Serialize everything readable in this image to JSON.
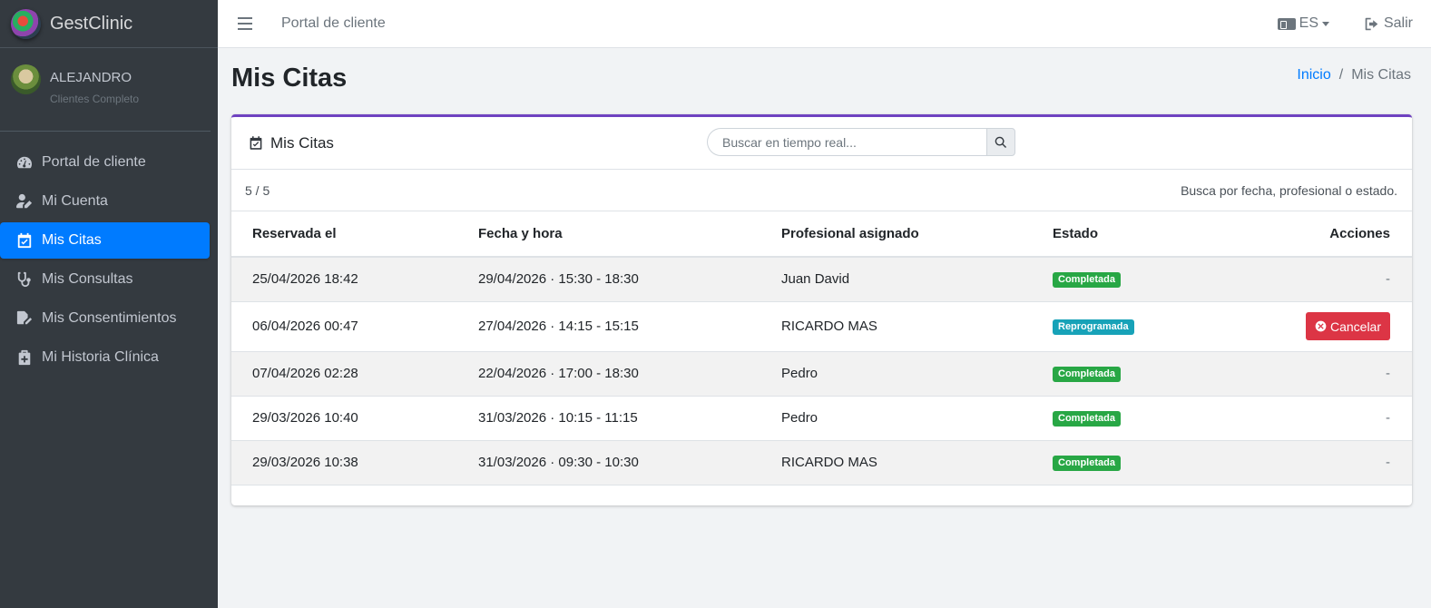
{
  "app": {
    "name": "GestClinic"
  },
  "user": {
    "name": "ALEJANDRO",
    "role": "Clientes Completo"
  },
  "sidebar": {
    "items": [
      {
        "label": "Portal de cliente",
        "icon": "tachometer-icon",
        "active": false
      },
      {
        "label": "Mi Cuenta",
        "icon": "user-edit-icon",
        "active": false
      },
      {
        "label": "Mis Citas",
        "icon": "calendar-check-icon",
        "active": true
      },
      {
        "label": "Mis Consultas",
        "icon": "stethoscope-icon",
        "active": false
      },
      {
        "label": "Mis Consentimientos",
        "icon": "file-signature-icon",
        "active": false
      },
      {
        "label": "Mi Historia Clínica",
        "icon": "briefcase-medical-icon",
        "active": false
      }
    ]
  },
  "topbar": {
    "link": "Portal de cliente",
    "language": "ES",
    "logout": "Salir"
  },
  "page": {
    "title": "Mis Citas",
    "breadcrumb": {
      "home": "Inicio",
      "separator": "/",
      "current": "Mis Citas"
    }
  },
  "card": {
    "title": "Mis Citas",
    "search_placeholder": "Buscar en tiempo real...",
    "count": "5 / 5",
    "hint": "Busca por fecha, profesional o estado.",
    "columns": [
      "Reservada el",
      "Fecha y hora",
      "Profesional asignado",
      "Estado",
      "Acciones"
    ],
    "rows": [
      {
        "booked": "25/04/2026 18:42",
        "datetime": "29/04/2026 · 15:30 - 18:30",
        "professional": "Juan David",
        "status": "Completada",
        "action": "-"
      },
      {
        "booked": "06/04/2026 00:47",
        "datetime": "27/04/2026 · 14:15 - 15:15",
        "professional": "RICARDO MAS",
        "status": "Reprogramada",
        "action": "Cancelar"
      },
      {
        "booked": "07/04/2026 02:28",
        "datetime": "22/04/2026 · 17:00 - 18:30",
        "professional": "Pedro",
        "status": "Completada",
        "action": "-"
      },
      {
        "booked": "29/03/2026 10:40",
        "datetime": "31/03/2026 · 10:15 - 11:15",
        "professional": "Pedro",
        "status": "Completada",
        "action": "-"
      },
      {
        "booked": "29/03/2026 10:38",
        "datetime": "31/03/2026 · 09:30 - 10:30",
        "professional": "RICARDO MAS",
        "status": "Completada",
        "action": "-"
      }
    ]
  },
  "colors": {
    "sidebar_bg": "#343a40",
    "active": "#007bff",
    "card_accent": "#6f42c1",
    "success": "#28a745",
    "info": "#17a2b8",
    "danger": "#dc3545"
  }
}
